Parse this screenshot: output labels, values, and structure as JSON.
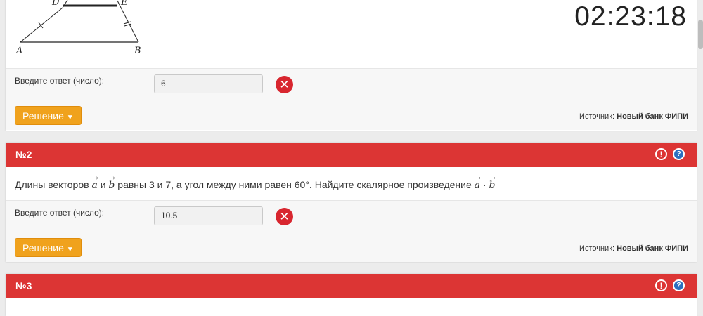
{
  "timer": "02:23:18",
  "q1": {
    "figure_labels": {
      "a": "A",
      "b": "B",
      "d": "D",
      "e": "E"
    },
    "answer_label": "Введите ответ (число):",
    "answer_value": "6",
    "solution_label": "Решение",
    "source_prefix": "Источник: ",
    "source_name": "Новый банк ФИПИ"
  },
  "q2": {
    "number": "№2",
    "text_part1": "Длины векторов ",
    "vec_a": "a",
    "text_and": " и ",
    "vec_b": "b",
    "text_part2": " равны 3 и 7, а угол между ними равен 60°. Найдите скалярное произведение ",
    "dot": " · ",
    "answer_label": "Введите ответ (число):",
    "answer_value": "10.5",
    "solution_label": "Решение",
    "source_prefix": "Источник: ",
    "source_name": "Новый банк ФИПИ"
  },
  "q3": {
    "number": "№3"
  },
  "icons": {
    "warn": "!",
    "help": "?",
    "wrong": "✕",
    "chevron": "⌄"
  },
  "colors": {
    "header_red": "#dc3534",
    "button_orange": "#f0a21d",
    "wrong_red": "#d8262f",
    "help_blue": "#2c6fc0"
  }
}
